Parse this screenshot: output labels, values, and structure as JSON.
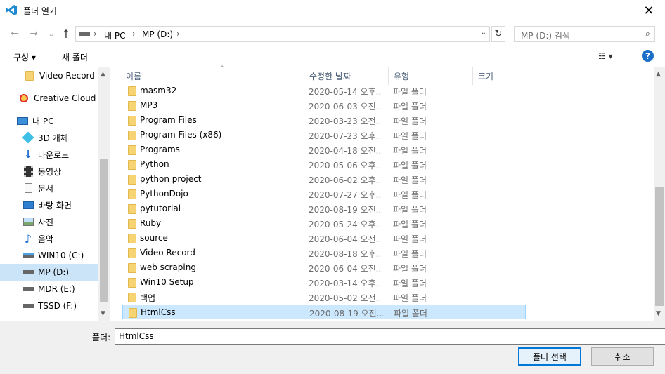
{
  "window": {
    "title": "폴더 열기",
    "close_glyph": "✕"
  },
  "nav": {
    "back_glyph": "←",
    "forward_glyph": "→",
    "recent_glyph": "⌄",
    "up_glyph": "↑",
    "breadcrumbs": [
      "내 PC",
      "MP (D:)"
    ],
    "sep_glyph": "›",
    "dropdown_glyph": "⌄",
    "refresh_glyph": "↻",
    "search_placeholder": "MP (D:) 검색",
    "search_glyph": "⌕"
  },
  "toolbar": {
    "organize": "구성 ▾",
    "new_folder": "새 폴더",
    "view": "☷ ▾",
    "help": "?"
  },
  "sidebar": {
    "items": [
      {
        "label": "Video Record",
        "icon": "folder-icon"
      },
      {
        "label": "Creative Cloud Fil",
        "icon": "creative-cloud-icon"
      },
      {
        "label": "내 PC",
        "icon": "computer-icon"
      },
      {
        "label": "3D 개체",
        "icon": "3d-objects-icon"
      },
      {
        "label": "다운로드",
        "icon": "download-icon"
      },
      {
        "label": "동영상",
        "icon": "video-icon"
      },
      {
        "label": "문서",
        "icon": "document-icon"
      },
      {
        "label": "바탕 화면",
        "icon": "desktop-icon"
      },
      {
        "label": "사진",
        "icon": "pictures-icon"
      },
      {
        "label": "음악",
        "icon": "music-icon"
      },
      {
        "label": "WIN10 (C:)",
        "icon": "drive-icon"
      },
      {
        "label": "MP (D:)",
        "icon": "drive-icon",
        "selected": true
      },
      {
        "label": "MDR (E:)",
        "icon": "drive-icon"
      },
      {
        "label": "TSSD (F:)",
        "icon": "drive-icon"
      }
    ]
  },
  "columns": {
    "name": "이름",
    "date": "수정한 날짜",
    "type": "유형",
    "size": "크기"
  },
  "files": [
    {
      "name": "masm32",
      "date": "2020-05-14 오후...",
      "type": "파일 폴더"
    },
    {
      "name": "MP3",
      "date": "2020-06-03 오전...",
      "type": "파일 폴더"
    },
    {
      "name": "Program Files",
      "date": "2020-03-23 오전...",
      "type": "파일 폴더"
    },
    {
      "name": "Program Files (x86)",
      "date": "2020-07-23 오후...",
      "type": "파일 폴더"
    },
    {
      "name": "Programs",
      "date": "2020-04-18 오전...",
      "type": "파일 폴더"
    },
    {
      "name": "Python",
      "date": "2020-05-06 오후...",
      "type": "파일 폴더"
    },
    {
      "name": "python project",
      "date": "2020-06-02 오후...",
      "type": "파일 폴더"
    },
    {
      "name": "PythonDojo",
      "date": "2020-07-27 오후...",
      "type": "파일 폴더"
    },
    {
      "name": "pytutorial",
      "date": "2020-08-19 오전...",
      "type": "파일 폴더"
    },
    {
      "name": "Ruby",
      "date": "2020-05-24 오후...",
      "type": "파일 폴더"
    },
    {
      "name": "source",
      "date": "2020-06-04 오전...",
      "type": "파일 폴더"
    },
    {
      "name": "Video Record",
      "date": "2020-08-18 오후...",
      "type": "파일 폴더"
    },
    {
      "name": "web scraping",
      "date": "2020-06-04 오전...",
      "type": "파일 폴더"
    },
    {
      "name": "Win10 Setup",
      "date": "2020-03-14 오후...",
      "type": "파일 폴더"
    },
    {
      "name": "백업",
      "date": "2020-05-02 오전...",
      "type": "파일 폴더"
    },
    {
      "name": "HtmlCss",
      "date": "2020-08-19 오전...",
      "type": "파일 폴더",
      "selected": true
    }
  ],
  "footer": {
    "folder_label": "폴더:",
    "folder_value": "HtmlCss",
    "select_button": "폴더 선택",
    "cancel_button": "취소"
  },
  "colors": {
    "accent": "#0078d7",
    "selection": "#cce8ff",
    "folder": "#f6d473"
  }
}
